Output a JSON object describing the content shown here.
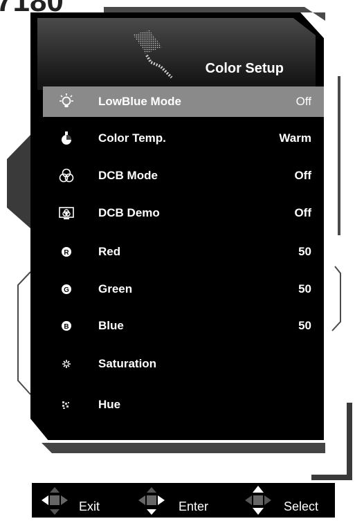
{
  "header": {
    "title": "Color Setup",
    "icon": "paint-roller-icon"
  },
  "menu": [
    {
      "label": "LowBlue Mode",
      "value": "Off",
      "icon": "bulb-icon",
      "selected": true
    },
    {
      "label": "Color Temp.",
      "value": "Warm",
      "icon": "thermometer-icon",
      "selected": false
    },
    {
      "label": "DCB Mode",
      "value": "Off",
      "icon": "rgb-circles-icon",
      "selected": false
    },
    {
      "label": "DCB Demo",
      "value": "Off",
      "icon": "monitor-demo-icon",
      "selected": false
    },
    {
      "label": "Red",
      "value": "50",
      "icon": "r-icon",
      "selected": false
    },
    {
      "label": "Green",
      "value": "50",
      "icon": "g-icon",
      "selected": false
    },
    {
      "label": "Blue",
      "value": "50",
      "icon": "b-icon",
      "selected": false
    },
    {
      "label": "Saturation",
      "value": "",
      "icon": "saturation-icon",
      "selected": false
    },
    {
      "label": "Hue",
      "value": "",
      "icon": "hue-icon",
      "selected": false
    }
  ],
  "footer": {
    "exit_label": "Exit",
    "enter_label": "Enter",
    "select_label": "Select"
  },
  "colors": {
    "panel_bg": "#000000",
    "selected_bg": "#8a8a8a",
    "text": "#ffffff"
  }
}
